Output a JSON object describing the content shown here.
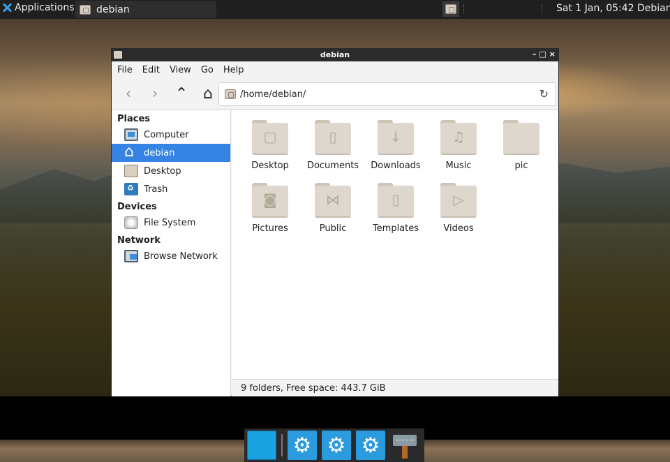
{
  "top_panel": {
    "applications_label": "Applications",
    "task_label": "debian",
    "clock": "Sat  1 Jan, 05:42",
    "user": "Debian"
  },
  "window": {
    "title": "debian",
    "controls": [
      "–",
      "□",
      "×"
    ],
    "menu": [
      "File",
      "Edit",
      "View",
      "Go",
      "Help"
    ],
    "location": "/home/debian/"
  },
  "sidebar": {
    "sections": [
      {
        "title": "Places",
        "items": [
          {
            "label": "Computer",
            "icon": "computer-icon"
          },
          {
            "label": "debian",
            "icon": "home-icon",
            "selected": true
          },
          {
            "label": "Desktop",
            "icon": "desktop-folder-icon"
          },
          {
            "label": "Trash",
            "icon": "trash-icon"
          }
        ]
      },
      {
        "title": "Devices",
        "items": [
          {
            "label": "File System",
            "icon": "drive-icon"
          }
        ]
      },
      {
        "title": "Network",
        "items": [
          {
            "label": "Browse Network",
            "icon": "network-icon"
          }
        ]
      }
    ]
  },
  "files": [
    {
      "name": "Desktop",
      "glyph": "▢"
    },
    {
      "name": "Documents",
      "glyph": "▯"
    },
    {
      "name": "Downloads",
      "glyph": "↓"
    },
    {
      "name": "Music",
      "glyph": "♫"
    },
    {
      "name": "pic",
      "glyph": ""
    },
    {
      "name": "Pictures",
      "glyph": "◙"
    },
    {
      "name": "Public",
      "glyph": "⋈"
    },
    {
      "name": "Templates",
      "glyph": "▯"
    },
    {
      "name": "Videos",
      "glyph": "▷"
    }
  ],
  "status": "9 folders, Free space: 443.7 GiB",
  "dock": {
    "sign_text": "~~~~"
  },
  "colors": {
    "selection": "#3584e4",
    "folder": "#ded7cd",
    "panel": "#1f1f1f"
  }
}
